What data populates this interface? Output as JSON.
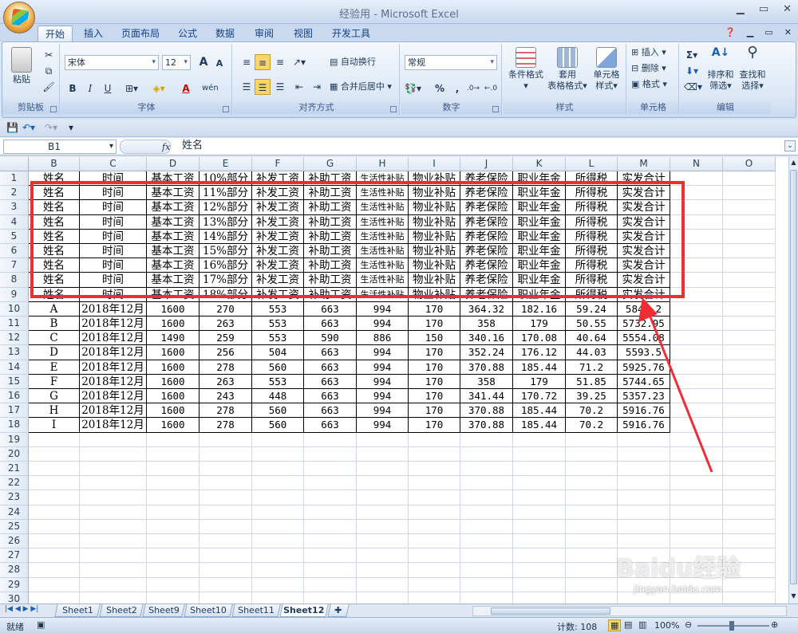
{
  "window": {
    "title": "经验用 - Microsoft Excel"
  },
  "tabs": [
    "开始",
    "插入",
    "页面布局",
    "公式",
    "数据",
    "审阅",
    "视图",
    "开发工具"
  ],
  "ribbon": {
    "clipboard": {
      "label": "剪贴板",
      "paste": "粘贴"
    },
    "font": {
      "label": "字体",
      "name": "宋体",
      "size": "12",
      "bold": "B",
      "italic": "I",
      "underline": "U",
      "grow": "A",
      "shrink": "A",
      "color_a": "A",
      "phonetic": "wén"
    },
    "align": {
      "label": "对齐方式",
      "wrap": "自动换行",
      "merge": "合并后居中"
    },
    "number": {
      "label": "数字",
      "format": "常规",
      "percent": "%",
      "comma": ","
    },
    "styles": {
      "label": "样式",
      "cond": "条件格式",
      "table_1": "套用",
      "table_2": "表格格式",
      "cell_1": "单元格",
      "cell_2": "样式"
    },
    "cells": {
      "label": "单元格",
      "insert": "插入",
      "delete": "删除",
      "format": "格式"
    },
    "editing": {
      "label": "编辑",
      "sort_1": "排序和",
      "sort_2": "筛选",
      "find_1": "查找和",
      "find_2": "选择"
    }
  },
  "formula": {
    "namebox": "B1",
    "fx": "fx",
    "value": "姓名"
  },
  "columns": [
    "B",
    "C",
    "D",
    "E",
    "F",
    "G",
    "H",
    "I",
    "J",
    "K",
    "L",
    "M",
    "N",
    "O"
  ],
  "rows": [
    [
      "姓名",
      "时间",
      "基本工资",
      "10%部分",
      "补发工资",
      "补助工资",
      "生活性补贴",
      "物业补贴",
      "养老保险",
      "职业年金",
      "所得税",
      "实发合计"
    ],
    [
      "姓名",
      "时间",
      "基本工资",
      "11%部分",
      "补发工资",
      "补助工资",
      "生活性补贴",
      "物业补贴",
      "养老保险",
      "职业年金",
      "所得税",
      "实发合计"
    ],
    [
      "姓名",
      "时间",
      "基本工资",
      "12%部分",
      "补发工资",
      "补助工资",
      "生活性补贴",
      "物业补贴",
      "养老保险",
      "职业年金",
      "所得税",
      "实发合计"
    ],
    [
      "姓名",
      "时间",
      "基本工资",
      "13%部分",
      "补发工资",
      "补助工资",
      "生活性补贴",
      "物业补贴",
      "养老保险",
      "职业年金",
      "所得税",
      "实发合计"
    ],
    [
      "姓名",
      "时间",
      "基本工资",
      "14%部分",
      "补发工资",
      "补助工资",
      "生活性补贴",
      "物业补贴",
      "养老保险",
      "职业年金",
      "所得税",
      "实发合计"
    ],
    [
      "姓名",
      "时间",
      "基本工资",
      "15%部分",
      "补发工资",
      "补助工资",
      "生活性补贴",
      "物业补贴",
      "养老保险",
      "职业年金",
      "所得税",
      "实发合计"
    ],
    [
      "姓名",
      "时间",
      "基本工资",
      "16%部分",
      "补发工资",
      "补助工资",
      "生活性补贴",
      "物业补贴",
      "养老保险",
      "职业年金",
      "所得税",
      "实发合计"
    ],
    [
      "姓名",
      "时间",
      "基本工资",
      "17%部分",
      "补发工资",
      "补助工资",
      "生活性补贴",
      "物业补贴",
      "养老保险",
      "职业年金",
      "所得税",
      "实发合计"
    ],
    [
      "姓名",
      "时间",
      "基本工资",
      "18%部分",
      "补发工资",
      "补助工资",
      "生活性补贴",
      "物业补贴",
      "养老保险",
      "职业年金",
      "所得税",
      "实发合计"
    ],
    [
      "A",
      "2018年12月",
      "1600",
      "270",
      "553",
      "663",
      "994",
      "170",
      "364.32",
      "182.16",
      "59.24",
      "5841.2"
    ],
    [
      "B",
      "2018年12月",
      "1600",
      "263",
      "553",
      "663",
      "994",
      "170",
      "358",
      "179",
      "50.55",
      "5732.95"
    ],
    [
      "C",
      "2018年12月",
      "1490",
      "259",
      "553",
      "590",
      "886",
      "150",
      "340.16",
      "170.08",
      "40.64",
      "5554.08"
    ],
    [
      "D",
      "2018年12月",
      "1600",
      "256",
      "504",
      "663",
      "994",
      "170",
      "352.24",
      "176.12",
      "44.03",
      "5593.5"
    ],
    [
      "E",
      "2018年12月",
      "1600",
      "278",
      "560",
      "663",
      "994",
      "170",
      "370.88",
      "185.44",
      "71.2",
      "5925.76"
    ],
    [
      "F",
      "2018年12月",
      "1600",
      "263",
      "553",
      "663",
      "994",
      "170",
      "358",
      "179",
      "51.85",
      "5744.65"
    ],
    [
      "G",
      "2018年12月",
      "1600",
      "243",
      "448",
      "663",
      "994",
      "170",
      "341.44",
      "170.72",
      "39.25",
      "5357.23"
    ],
    [
      "H",
      "2018年12月",
      "1600",
      "278",
      "560",
      "663",
      "994",
      "170",
      "370.88",
      "185.44",
      "70.2",
      "5916.76"
    ],
    [
      "I",
      "2018年12月",
      "1600",
      "278",
      "560",
      "663",
      "994",
      "170",
      "370.88",
      "185.44",
      "70.2",
      "5916.76"
    ]
  ],
  "row_numbers": [
    "1",
    "2",
    "3",
    "4",
    "5",
    "6",
    "7",
    "8",
    "9",
    "10",
    "11",
    "12",
    "13",
    "14",
    "15",
    "16",
    "17",
    "18",
    "19",
    "20",
    "21",
    "22",
    "23",
    "24",
    "25",
    "26",
    "27",
    "28",
    "29",
    "30"
  ],
  "sheets": [
    "Sheet1",
    "Sheet2",
    "Sheet9",
    "Sheet10",
    "Sheet11",
    "Sheet12"
  ],
  "active_sheet": "Sheet12",
  "status": {
    "ready": "就绪",
    "count": "计数: 108",
    "zoom": "100%"
  },
  "watermark": {
    "brand": "Baidu经验",
    "url": "jingyan.baidu.com"
  },
  "colors": {
    "highlight": "#f02d32",
    "header_bg": "#dfe7f2"
  }
}
